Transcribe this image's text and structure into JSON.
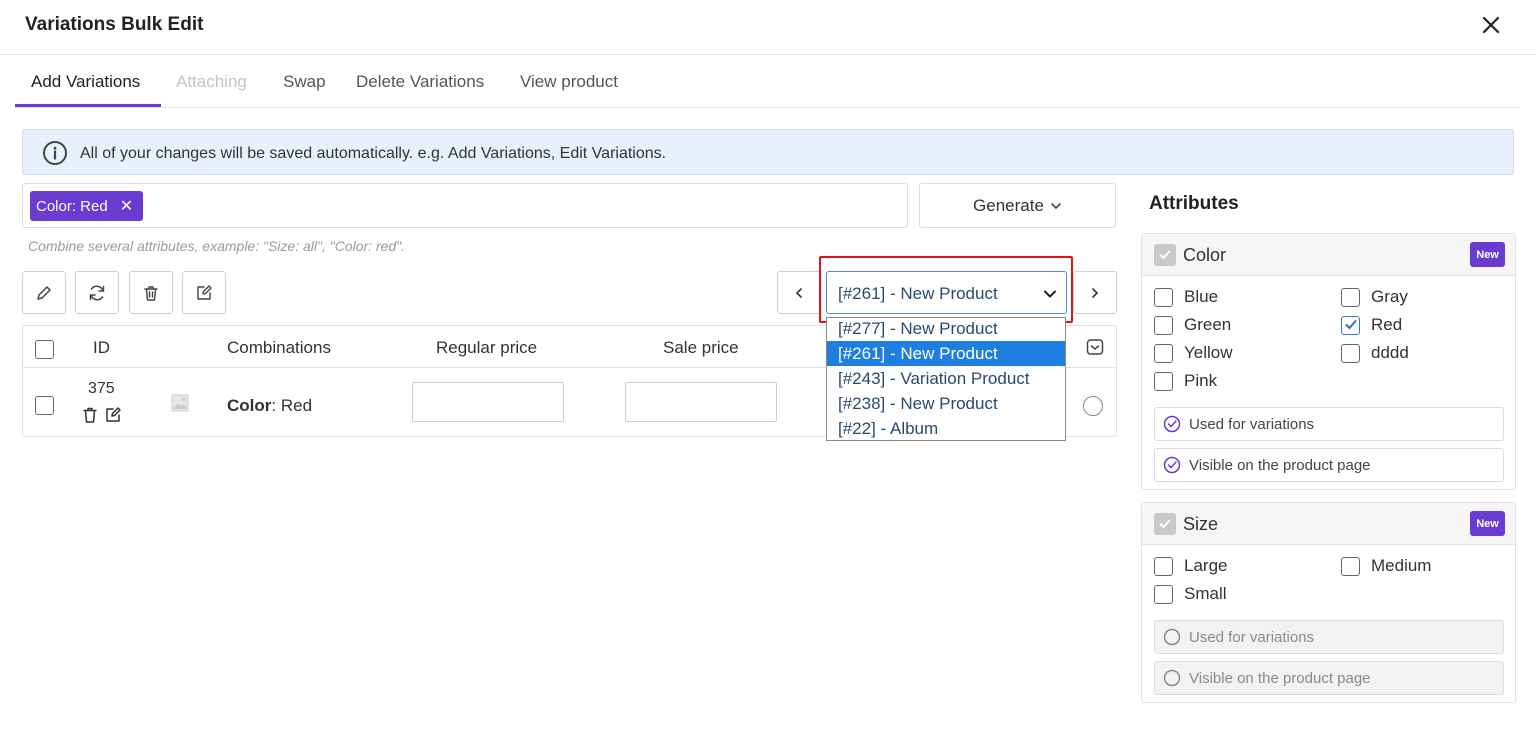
{
  "header": {
    "title": "Variations Bulk Edit",
    "close_icon": "close-icon"
  },
  "tabs": [
    {
      "label": "Add Variations",
      "active": true
    },
    {
      "label": "Attaching",
      "disabled": true
    },
    {
      "label": "Swap"
    },
    {
      "label": "Delete Variations"
    },
    {
      "label": "View product"
    }
  ],
  "notice": {
    "text": "All of your changes will be saved automatically. e.g. Add Variations, Edit Variations.",
    "icon": "info-icon"
  },
  "attribute_input": {
    "chips": [
      {
        "label": "Color: Red"
      }
    ],
    "hint": "Combine several attributes, example: \"Size: all\", \"Color: red\"."
  },
  "generate_button": {
    "label": "Generate"
  },
  "toolbar": {
    "icons": [
      "pencil-icon",
      "refresh-icon",
      "trash-icon",
      "edit-square-icon"
    ]
  },
  "product_select": {
    "value": "[#261] - New Product",
    "options": [
      {
        "label": "[#277] - New Product"
      },
      {
        "label": "[#261] - New Product",
        "selected": true
      },
      {
        "label": "[#243] - Variation Product"
      },
      {
        "label": "[#238] - New Product"
      },
      {
        "label": "[#22] - Album"
      }
    ]
  },
  "table": {
    "headers": {
      "id": "ID",
      "combinations": "Combinations",
      "regular_price": "Regular price",
      "sale_price": "Sale price"
    },
    "rows": [
      {
        "id": "375",
        "combo_attr": "Color",
        "combo_value": ": Red",
        "regular_price": "",
        "sale_price": ""
      }
    ]
  },
  "attributes": {
    "title": "Attributes",
    "panels": [
      {
        "name": "Color",
        "badge": "New",
        "terms": [
          {
            "label": "Blue",
            "checked": false
          },
          {
            "label": "Gray",
            "checked": false
          },
          {
            "label": "Green",
            "checked": false
          },
          {
            "label": "Red",
            "checked": true
          },
          {
            "label": "Yellow",
            "checked": false
          },
          {
            "label": "dddd",
            "checked": false
          },
          {
            "label": "Pink",
            "checked": false
          }
        ],
        "options": [
          {
            "label": "Used for variations",
            "enabled": true
          },
          {
            "label": "Visible on the product page",
            "enabled": true
          }
        ]
      },
      {
        "name": "Size",
        "badge": "New",
        "terms": [
          {
            "label": "Large",
            "checked": false
          },
          {
            "label": "Medium",
            "checked": false
          },
          {
            "label": "Small",
            "checked": false
          }
        ],
        "options": [
          {
            "label": "Used for variations",
            "enabled": false
          },
          {
            "label": "Visible on the product page",
            "enabled": false
          }
        ]
      }
    ]
  },
  "colors": {
    "accent": "#6a3bd1",
    "highlight": "#e3131a",
    "selected_option": "#1e7fe0",
    "notice_bg": "#e8f0fb"
  }
}
